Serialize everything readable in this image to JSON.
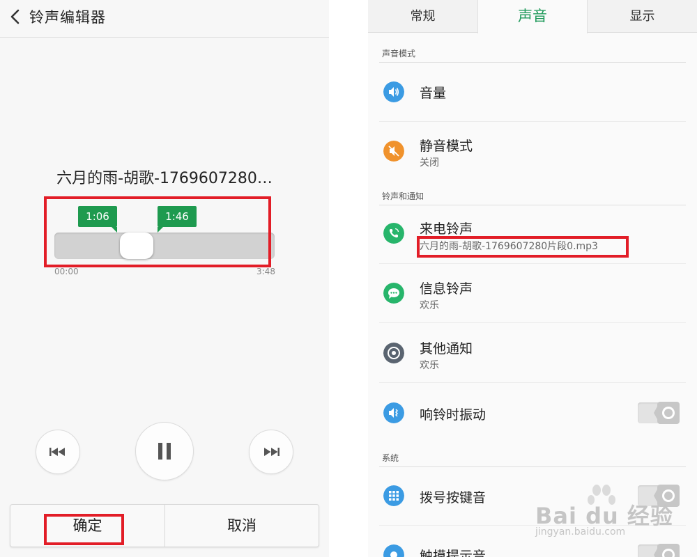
{
  "left": {
    "title": "铃声编辑器",
    "song_title": "六月的雨-胡歌-1769607280…",
    "marker_start": "1:06",
    "marker_end": "1:46",
    "time_start": "00:00",
    "time_end": "3:48",
    "selection_start_fraction": 0.29,
    "selection_end_fraction": 0.46,
    "confirm_label": "确定",
    "cancel_label": "取消",
    "icons": {
      "back": "chevron-left-icon",
      "prev": "previous-track-icon",
      "pause": "pause-icon",
      "next": "next-track-icon"
    }
  },
  "right": {
    "tabs": [
      {
        "label": "常规"
      },
      {
        "label": "声音"
      },
      {
        "label": "显示"
      }
    ],
    "active_tab_color": "#1e9a5a",
    "sections": {
      "sound_mode": "声音模式",
      "ringtone_notify": "铃声和通知",
      "system": "系统"
    },
    "rows": [
      {
        "title": "音量",
        "icon": "volume-icon",
        "color": "#3b9be3"
      },
      {
        "title": "静音模式",
        "sub": "关闭",
        "icon": "mute-icon",
        "color": "#f0922c"
      },
      {
        "title": "来电铃声",
        "sub": "六月的雨-胡歌-1769607280片段0.mp3",
        "icon": "phone-ring-icon",
        "color": "#27b56b"
      },
      {
        "title": "信息铃声",
        "sub": "欢乐",
        "icon": "message-icon",
        "color": "#27b56b"
      },
      {
        "title": "其他通知",
        "sub": "欢乐",
        "icon": "notification-disc-icon",
        "color": "#5a6470"
      },
      {
        "title": "响铃时振动",
        "icon": "vibrate-icon",
        "color": "#3b9be3",
        "toggle": false
      },
      {
        "title": "拨号按键音",
        "icon": "dialpad-icon",
        "color": "#3b9be3",
        "toggle": false
      },
      {
        "title": "触摸提示音",
        "icon": "touch-icon",
        "color": "#3b9be3",
        "toggle": false
      }
    ]
  },
  "watermark": {
    "brand": "Bai du 经验",
    "url": "jingyan.baidu.com"
  },
  "highlight_color": "#e21d27",
  "marker_color": "#1e9a4f"
}
